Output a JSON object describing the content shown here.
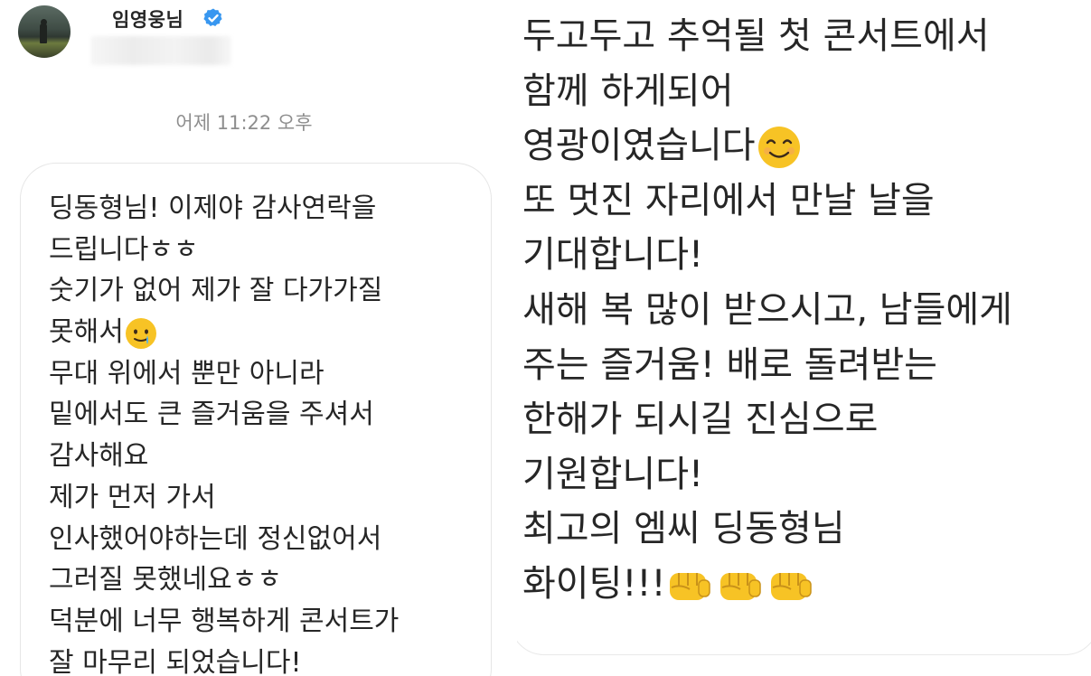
{
  "profile": {
    "username": "임영웅님",
    "avatar_icon": "profile-photo",
    "verified_icon": "verified-badge-icon",
    "verified_color": "#3897f0"
  },
  "chat": {
    "timestamp": "어제 11:22 오후"
  },
  "message_left": {
    "lines": [
      "딩동형님! 이제야 감사연락을",
      "드립니다ㅎㅎ",
      "숫기가 없어 제가 잘 다가가질",
      "못해서",
      "무대 위에서 뿐만 아니라",
      "밑에서도 큰 즐거움을 주셔서",
      "감사해요",
      "제가 먼저 가서",
      "인사했어야하는데 정신없어서",
      "그러질 못했네요ㅎㅎ",
      "덕분에 너무 행복하게 콘서트가",
      "잘 마무리 되었습니다!"
    ],
    "emoji_after_line_4": "tearful-smile-emoji"
  },
  "message_right": {
    "lines": [
      "두고두고 추억될 첫 콘서트에서",
      "함께 하게되어",
      "영광이였습니다",
      "또 멋진 자리에서 만날 날을",
      "기대합니다!",
      "새해 복 많이 받으시고, 남들에게",
      "주는 즐거움! 배로 돌려받는",
      "한해가 되시길 진심으로",
      "기원합니다!",
      "최고의 엠씨 딩동형님",
      "화이팅!!!"
    ],
    "emoji_after_line_3": "smiling-face-emoji",
    "emoji_after_line_11": [
      "fist-emoji",
      "fist-emoji",
      "fist-emoji"
    ]
  },
  "colors": {
    "text": "#262626",
    "timestamp": "#8e8e8e",
    "bubble_border": "#e6e6e6",
    "emoji_yellow": "#f7c325"
  }
}
